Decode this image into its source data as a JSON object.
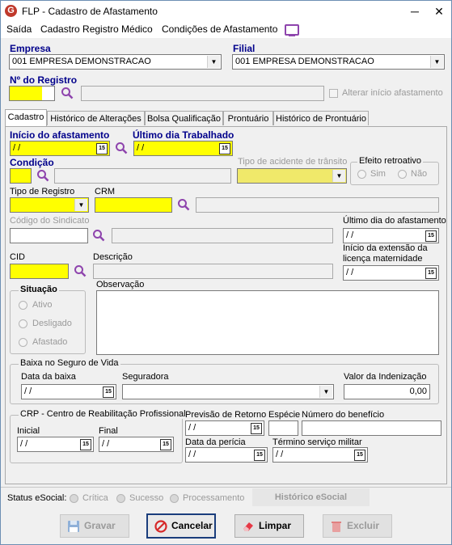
{
  "window": {
    "title": "FLP - Cadastro de Afastamento",
    "icon_letter": "G",
    "minimize": "─",
    "close": "✕"
  },
  "menu": {
    "exit": "Saída",
    "medical": "Cadastro Registro Médico",
    "conditions": "Condições de Afastamento"
  },
  "company": {
    "label": "Empresa",
    "value": "001 EMPRESA DEMONSTRACAO"
  },
  "branch": {
    "label": "Filial",
    "value": "001 EMPRESA DEMONSTRACAO"
  },
  "registry": {
    "label": "Nº do Registro",
    "change_start_label": "Alterar início afastamento"
  },
  "tabs": [
    "Cadastro",
    "Histórico de Alterações",
    "Bolsa Qualificação",
    "Prontuário",
    "Histórico de Prontuário"
  ],
  "form": {
    "start_label": "Início do afastamento",
    "start_value": " / /",
    "lastday_label": "Último dia Trabalhado",
    "lastday_value": " / /",
    "condition_label": "Condição",
    "accident_label": "Tipo de acidente de trânsito",
    "retro_label": "Efeito retroativo",
    "retro_yes": "Sim",
    "retro_no": "Não",
    "regtype_label": "Tipo de Registro",
    "crm_label": "CRM",
    "union_label": "Código do Sindicato",
    "leave_lastday_label": "Último dia do afastamento",
    "leave_lastday_value": " / /",
    "maternity_label_1": "Início da extensão da",
    "maternity_label_2": "licença maternidade",
    "maternity_value": " / /",
    "cid_label": "CID",
    "description_label": "Descrição",
    "situation_label": "Situação",
    "situation_active": "Ativo",
    "situation_off": "Desligado",
    "situation_away": "Afastado",
    "observation_label": "Observação"
  },
  "insurance": {
    "group_label": "Baixa no Seguro de Vida",
    "date_label": "Data da baixa",
    "date_value": " / /",
    "insurer_label": "Seguradora",
    "indemnity_label": "Valor da Indenização",
    "indemnity_value": "0,00"
  },
  "crp": {
    "group_label": "CRP - Centro de Reabilitação Profissional",
    "start_label": "Inicial",
    "start_value": " / /",
    "end_label": "Final",
    "end_value": " / /"
  },
  "extra": {
    "return_label": "Previsão de Retorno",
    "return_value": " / /",
    "species_label": "Espécie",
    "benefit_label": "Número do benefício",
    "expertise_label": "Data da perícia",
    "expertise_value": " / /",
    "military_label": "Término serviço militar",
    "military_value": " / /"
  },
  "esocial": {
    "label": "Status eSocial:",
    "critical": "Crítica",
    "success": "Sucesso",
    "processing": "Processamento",
    "history_button": "Histórico eSocial"
  },
  "buttons": {
    "save": "Gravar",
    "cancel": "Cancelar",
    "clear": "Limpar",
    "delete": "Excluir"
  },
  "icons": {
    "search": "magnifier-icon",
    "calendar": "calendar-icon",
    "dropdown": "chevron-down-icon"
  },
  "colors": {
    "required_field": "#ffff00",
    "label_blue": "#00008b",
    "search_icon": "#8e44ad"
  }
}
